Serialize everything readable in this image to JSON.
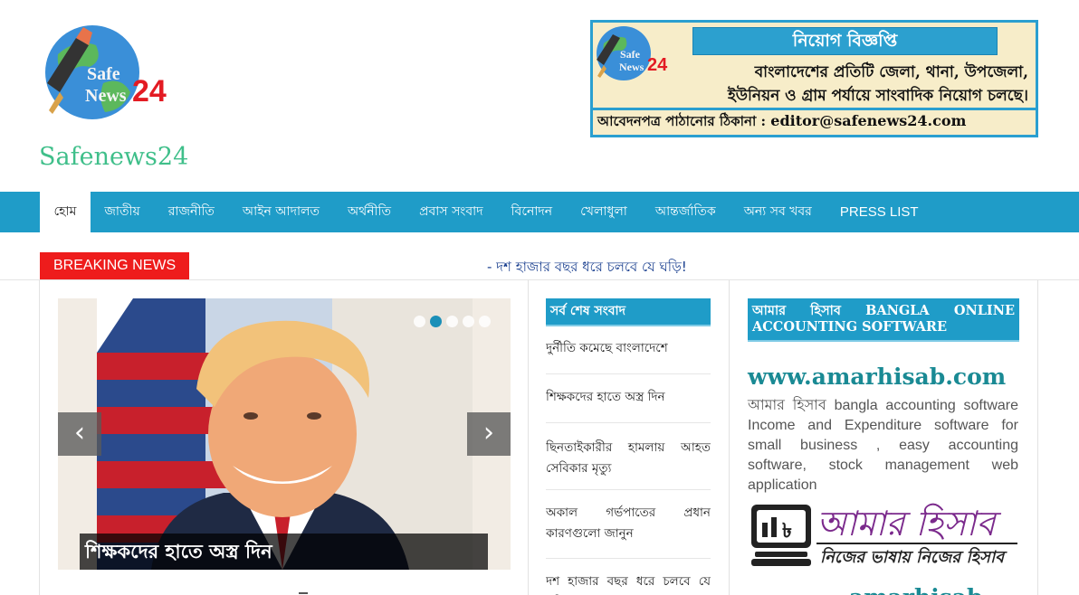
{
  "header": {
    "logo_text": {
      "line1": "Safe",
      "line2": "News",
      "num": "24"
    },
    "site_name": "Safenews24"
  },
  "ad": {
    "logo_text": {
      "line1": "Safe",
      "line2": "News",
      "num": "24"
    },
    "title": "নিয়োগ বিজ্ঞপ্তি",
    "line1": "বাংলাদেশের প্রতিটি জেলা, থানা, উপজেলা,",
    "line2": "ইউনিয়ন ও গ্রাম পর্যায়ে সাংবাদিক নিয়োগ চলছে।",
    "line3_prefix": "আবেদনপত্র পাঠানোর ঠিকানা : ",
    "email": "editor@safenews24.com"
  },
  "nav": {
    "items": [
      {
        "label": "হোম"
      },
      {
        "label": "জাতীয়"
      },
      {
        "label": "রাজনীতি"
      },
      {
        "label": "আইন আদালত"
      },
      {
        "label": "অর্থনীতি"
      },
      {
        "label": "প্রবাস সংবাদ"
      },
      {
        "label": "বিনোদন"
      },
      {
        "label": "খেলাধুলা"
      },
      {
        "label": "আন্তর্জাতিক"
      },
      {
        "label": "অন্য সব খবর"
      },
      {
        "label": "PRESS LIST"
      }
    ]
  },
  "breaking": {
    "label": "BREAKING NEWS",
    "text": "- দশ হাজার বছর ধরে চলবে যে ঘড়ি!"
  },
  "slider": {
    "caption": "শিক্ষকদের হাতে অস্ত্র দিন",
    "prev": "‹",
    "next": "›",
    "dot_count": 5,
    "active_dot": 2
  },
  "latest": {
    "title": "সর্ব শেষ সংবাদ",
    "items": [
      "দুর্নীতি কমেছে বাংলাদেশে",
      "শিক্ষকদের হাতে অস্ত্র দিন",
      "ছিনতাইকারীর হামলায় আহত সেবিকার মৃত্যু",
      "অকাল গর্ভপাতের প্রধান কারণগুলো জানুন",
      "দশ হাজার বছর ধরে চলবে যে ঘড়ি!"
    ]
  },
  "sidebar": {
    "widget_title": "আমার হিসাব BANGLA ONLINE ACCOUNTING SOFTWARE",
    "site_url": "www.amarhisab.com",
    "description": "আমার হিসাব bangla accounting software Income and Expenditure software for small business , easy accounting software, stock management web application",
    "logo_text": "আমার হিসাব",
    "logo_tagline": "নিজের ভাষায় নিজের হিসাব",
    "partial_text": "amarhisab"
  },
  "colors": {
    "nav_bg": "#1f9cc8",
    "breaking_red": "#ee1c1c",
    "site_name_green": "#3fbf8a",
    "link_blue": "#1a3f8f",
    "url_teal": "#1a8a94",
    "logo_purple": "#7b2a8c"
  }
}
